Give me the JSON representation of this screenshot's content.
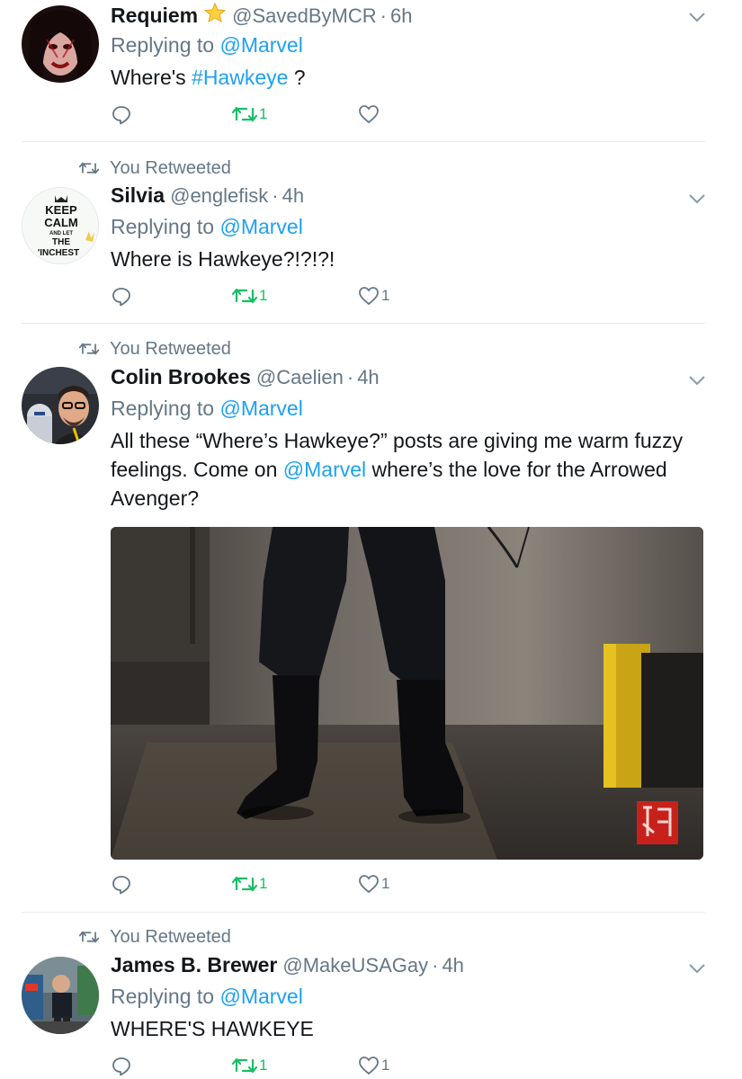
{
  "tweets": [
    {
      "retweeted_label": "",
      "name": "Requiem",
      "has_star": true,
      "handle": "@SavedByMCR",
      "time": "6h",
      "replying_prefix": "Replying to",
      "replying_to": "@Marvel",
      "text_before": "Where's ",
      "hashtag": "#Hawkeye",
      "text_after": " ?",
      "retweet_count": "1",
      "like_count": ""
    },
    {
      "retweeted_label": "You Retweeted",
      "name": "Silvia",
      "handle": "@englefisk",
      "time": "4h",
      "replying_prefix": "Replying to",
      "replying_to": "@Marvel",
      "text": "Where is Hawkeye?!?!?!",
      "retweet_count": "1",
      "like_count": "1",
      "avatar_text": [
        "KEEP",
        "CALM",
        "AND LET",
        "THE",
        "'INCHEST"
      ]
    },
    {
      "retweeted_label": "You Retweeted",
      "name": "Colin Brookes",
      "handle": "@Caelien",
      "time": "4h",
      "replying_prefix": "Replying to",
      "replying_to": "@Marvel",
      "text_part1": "All these “Where’s Hawkeye?” posts are giving me warm fuzzy feelings. Come on ",
      "mention": "@Marvel",
      "text_part2": " where’s the love for the Arrowed Avenger?",
      "retweet_count": "1",
      "like_count": "1"
    },
    {
      "retweeted_label": "You Retweeted",
      "name": "James B. Brewer",
      "handle": "@MakeUSAGay",
      "time": "4h",
      "replying_prefix": "Replying to",
      "replying_to": "@Marvel",
      "text": "WHERE'S HAWKEYE",
      "retweet_count": "1",
      "like_count": "1"
    }
  ],
  "colors": {
    "link": "#1da1f2",
    "muted": "#657786",
    "retweet_green": "#17bf63",
    "divider": "#e6ecf0"
  },
  "icons": {
    "reply": "reply-icon",
    "retweet": "retweet-icon",
    "like": "heart-icon",
    "caret": "chevron-down-icon",
    "star": "star-icon"
  }
}
